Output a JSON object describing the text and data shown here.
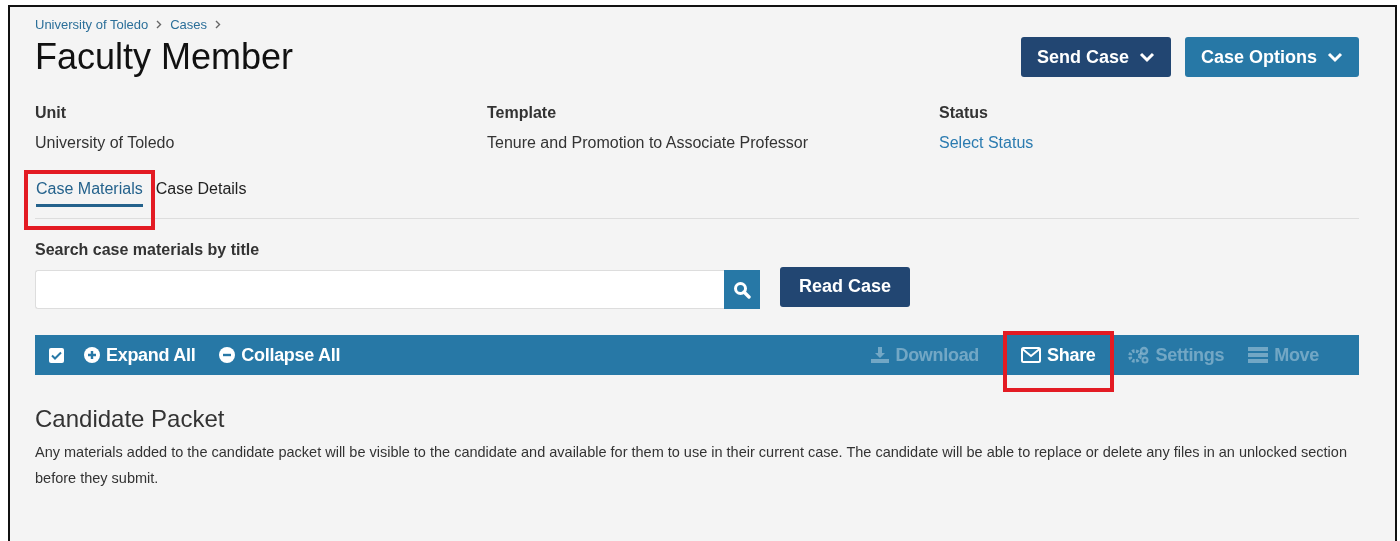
{
  "breadcrumbs": [
    "University of Toledo",
    "Cases"
  ],
  "title": "Faculty Member",
  "header_buttons": [
    {
      "label": "Send Case",
      "kind": "dark"
    },
    {
      "label": "Case Options",
      "kind": "light"
    }
  ],
  "fields": [
    {
      "label": "Unit",
      "value": "University of Toledo",
      "kind": "text"
    },
    {
      "label": "Template",
      "value": "Tenure and Promotion to Associate Professor",
      "kind": "text"
    },
    {
      "label": "Status",
      "value": "Select Status",
      "kind": "link"
    }
  ],
  "tabs": [
    {
      "label": "Case Materials",
      "selected": true,
      "highlighted": true
    },
    {
      "label": "Case Details",
      "selected": false,
      "highlighted": false
    }
  ],
  "search": {
    "label": "Search case materials by title"
  },
  "read_button": "Read Case",
  "toolbar": {
    "select_all_checked": true,
    "left_actions": [
      {
        "label": "Expand All",
        "kind": "expand"
      },
      {
        "label": "Collapse All",
        "kind": "collapse"
      }
    ],
    "right_actions": [
      {
        "label": "Download",
        "kind": "download",
        "disabled": true,
        "highlighted": false
      },
      {
        "label": "Share",
        "kind": "share",
        "disabled": false,
        "highlighted": true
      },
      {
        "label": "Settings",
        "kind": "settings",
        "disabled": true,
        "highlighted": false
      },
      {
        "label": "Move",
        "kind": "move",
        "disabled": true,
        "highlighted": false
      }
    ]
  },
  "section": {
    "title": "Candidate Packet",
    "description": "Any materials added to the candidate packet will be visible to the candidate and available for them to use in their current case. The candidate will be able to replace or delete any files in an unlocked section before they submit."
  }
}
